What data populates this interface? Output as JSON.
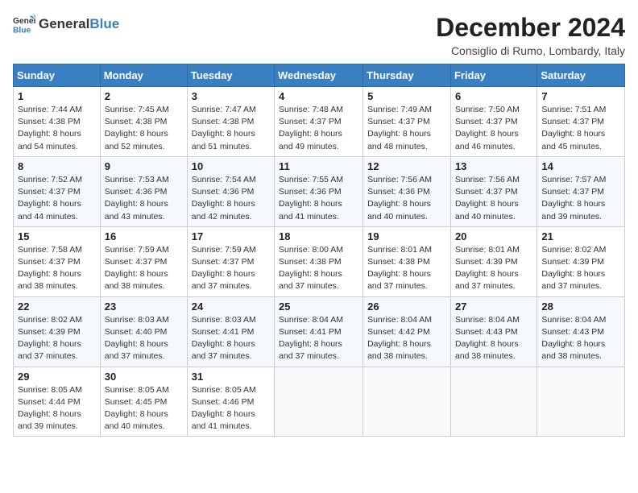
{
  "logo": {
    "general": "General",
    "blue": "Blue"
  },
  "title": "December 2024",
  "location": "Consiglio di Rumo, Lombardy, Italy",
  "weekdays": [
    "Sunday",
    "Monday",
    "Tuesday",
    "Wednesday",
    "Thursday",
    "Friday",
    "Saturday"
  ],
  "weeks": [
    [
      {
        "day": "1",
        "sunrise": "7:44 AM",
        "sunset": "4:38 PM",
        "daylight": "8 hours and 54 minutes."
      },
      {
        "day": "2",
        "sunrise": "7:45 AM",
        "sunset": "4:38 PM",
        "daylight": "8 hours and 52 minutes."
      },
      {
        "day": "3",
        "sunrise": "7:47 AM",
        "sunset": "4:38 PM",
        "daylight": "8 hours and 51 minutes."
      },
      {
        "day": "4",
        "sunrise": "7:48 AM",
        "sunset": "4:37 PM",
        "daylight": "8 hours and 49 minutes."
      },
      {
        "day": "5",
        "sunrise": "7:49 AM",
        "sunset": "4:37 PM",
        "daylight": "8 hours and 48 minutes."
      },
      {
        "day": "6",
        "sunrise": "7:50 AM",
        "sunset": "4:37 PM",
        "daylight": "8 hours and 46 minutes."
      },
      {
        "day": "7",
        "sunrise": "7:51 AM",
        "sunset": "4:37 PM",
        "daylight": "8 hours and 45 minutes."
      }
    ],
    [
      {
        "day": "8",
        "sunrise": "7:52 AM",
        "sunset": "4:37 PM",
        "daylight": "8 hours and 44 minutes."
      },
      {
        "day": "9",
        "sunrise": "7:53 AM",
        "sunset": "4:36 PM",
        "daylight": "8 hours and 43 minutes."
      },
      {
        "day": "10",
        "sunrise": "7:54 AM",
        "sunset": "4:36 PM",
        "daylight": "8 hours and 42 minutes."
      },
      {
        "day": "11",
        "sunrise": "7:55 AM",
        "sunset": "4:36 PM",
        "daylight": "8 hours and 41 minutes."
      },
      {
        "day": "12",
        "sunrise": "7:56 AM",
        "sunset": "4:36 PM",
        "daylight": "8 hours and 40 minutes."
      },
      {
        "day": "13",
        "sunrise": "7:56 AM",
        "sunset": "4:37 PM",
        "daylight": "8 hours and 40 minutes."
      },
      {
        "day": "14",
        "sunrise": "7:57 AM",
        "sunset": "4:37 PM",
        "daylight": "8 hours and 39 minutes."
      }
    ],
    [
      {
        "day": "15",
        "sunrise": "7:58 AM",
        "sunset": "4:37 PM",
        "daylight": "8 hours and 38 minutes."
      },
      {
        "day": "16",
        "sunrise": "7:59 AM",
        "sunset": "4:37 PM",
        "daylight": "8 hours and 38 minutes."
      },
      {
        "day": "17",
        "sunrise": "7:59 AM",
        "sunset": "4:37 PM",
        "daylight": "8 hours and 37 minutes."
      },
      {
        "day": "18",
        "sunrise": "8:00 AM",
        "sunset": "4:38 PM",
        "daylight": "8 hours and 37 minutes."
      },
      {
        "day": "19",
        "sunrise": "8:01 AM",
        "sunset": "4:38 PM",
        "daylight": "8 hours and 37 minutes."
      },
      {
        "day": "20",
        "sunrise": "8:01 AM",
        "sunset": "4:39 PM",
        "daylight": "8 hours and 37 minutes."
      },
      {
        "day": "21",
        "sunrise": "8:02 AM",
        "sunset": "4:39 PM",
        "daylight": "8 hours and 37 minutes."
      }
    ],
    [
      {
        "day": "22",
        "sunrise": "8:02 AM",
        "sunset": "4:39 PM",
        "daylight": "8 hours and 37 minutes."
      },
      {
        "day": "23",
        "sunrise": "8:03 AM",
        "sunset": "4:40 PM",
        "daylight": "8 hours and 37 minutes."
      },
      {
        "day": "24",
        "sunrise": "8:03 AM",
        "sunset": "4:41 PM",
        "daylight": "8 hours and 37 minutes."
      },
      {
        "day": "25",
        "sunrise": "8:04 AM",
        "sunset": "4:41 PM",
        "daylight": "8 hours and 37 minutes."
      },
      {
        "day": "26",
        "sunrise": "8:04 AM",
        "sunset": "4:42 PM",
        "daylight": "8 hours and 38 minutes."
      },
      {
        "day": "27",
        "sunrise": "8:04 AM",
        "sunset": "4:43 PM",
        "daylight": "8 hours and 38 minutes."
      },
      {
        "day": "28",
        "sunrise": "8:04 AM",
        "sunset": "4:43 PM",
        "daylight": "8 hours and 38 minutes."
      }
    ],
    [
      {
        "day": "29",
        "sunrise": "8:05 AM",
        "sunset": "4:44 PM",
        "daylight": "8 hours and 39 minutes."
      },
      {
        "day": "30",
        "sunrise": "8:05 AM",
        "sunset": "4:45 PM",
        "daylight": "8 hours and 40 minutes."
      },
      {
        "day": "31",
        "sunrise": "8:05 AM",
        "sunset": "4:46 PM",
        "daylight": "8 hours and 41 minutes."
      },
      null,
      null,
      null,
      null
    ]
  ]
}
